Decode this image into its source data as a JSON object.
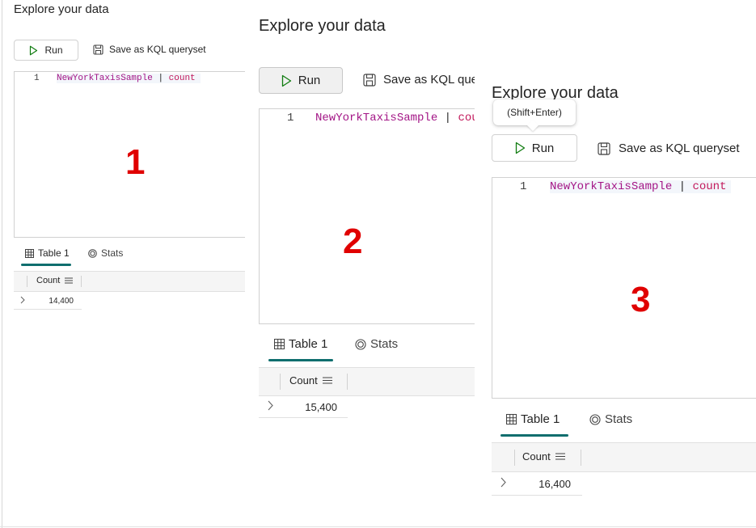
{
  "panels": [
    {
      "title": "Explore your data",
      "run_label": "Run",
      "save_label": "Save as KQL queryset",
      "line_number": "1",
      "code_table": "NewYorkTaxisSample",
      "code_pipe": "|",
      "code_keyword": "count",
      "annotation": "1",
      "tabs": [
        "Table 1",
        "Stats"
      ],
      "column_header": "Count",
      "row_value": "14,400"
    },
    {
      "title": "Explore your data",
      "run_label": "Run",
      "save_label": "Save as KQL que",
      "line_number": "1",
      "code_table": "NewYorkTaxisSample",
      "code_pipe": "|",
      "code_keyword": "cou",
      "annotation": "2",
      "tabs": [
        "Table 1",
        "Stats"
      ],
      "column_header": "Count",
      "row_value": "15,400"
    },
    {
      "title": "Explore your data",
      "tooltip": "(Shift+Enter)",
      "run_label": "Run",
      "save_label": "Save as KQL queryset",
      "line_number": "1",
      "code_table": "NewYorkTaxisSample",
      "code_pipe": "|",
      "code_keyword": "count",
      "annotation": "3",
      "tabs": [
        "Table 1",
        "Stats"
      ],
      "column_header": "Count",
      "row_value": "16,400"
    }
  ],
  "icons": {
    "run": "play-icon",
    "save": "save-icon",
    "table": "table-icon",
    "stats": "stats-icon",
    "column_menu": "menu-icon",
    "expand": "chevron-right-icon"
  },
  "colors": {
    "annotation": "#e00000",
    "tab_underline": "#0f6e6e",
    "run_icon": "#107c10",
    "code_table": "#a31586",
    "code_keyword": "#c2185b"
  }
}
